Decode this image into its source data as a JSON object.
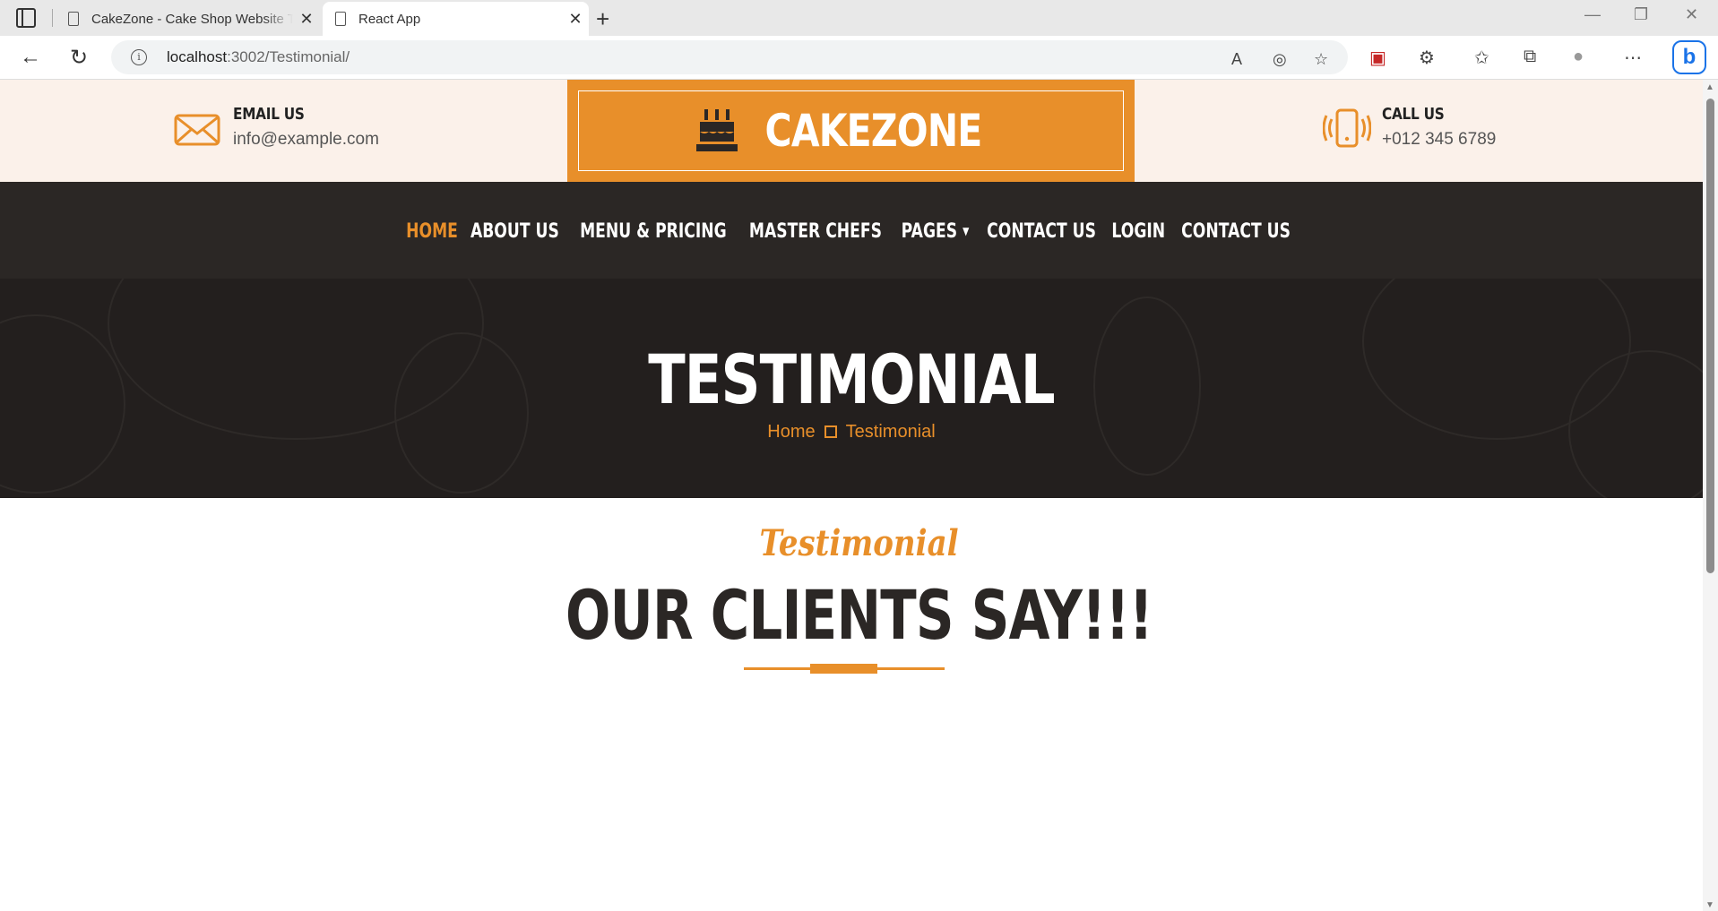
{
  "browser": {
    "tabs": [
      {
        "title": "CakeZone - Cake Shop Website Template"
      },
      {
        "title": "React App"
      }
    ],
    "url_host": "localhost",
    "url_rest": ":3002/Testimonial/"
  },
  "header": {
    "email_label": "EMAIL US",
    "email_value": "info@example.com",
    "logo": "CAKEZONE",
    "call_label": "CALL US",
    "call_value": "+012 345 6789"
  },
  "nav": {
    "items": [
      {
        "label": "HOME"
      },
      {
        "label": "ABOUT US"
      },
      {
        "label": "MENU & PRICING"
      },
      {
        "label": "MASTER CHEFS"
      },
      {
        "label": "PAGES"
      },
      {
        "label": "CONTACT US"
      },
      {
        "label": "LOGIN"
      },
      {
        "label": "CONTACT US"
      }
    ]
  },
  "hero": {
    "title": "TESTIMONIAL",
    "breadcrumb_home": "Home",
    "breadcrumb_current": "Testimonial"
  },
  "section": {
    "subtitle": "Testimonial",
    "title": "OUR CLIENTS SAY!!!"
  },
  "colors": {
    "accent": "#e88f2a",
    "dark": "#2b2725",
    "topbar_bg": "#fbf1ea"
  }
}
